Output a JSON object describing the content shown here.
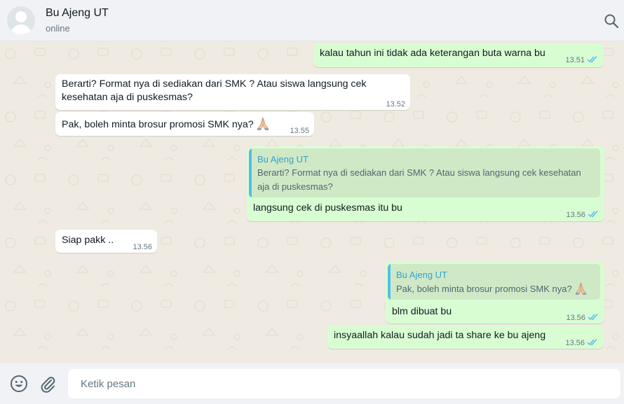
{
  "header": {
    "contact_name": "Bu Ajeng UT",
    "status": "online"
  },
  "messages": [
    {
      "direction": "outgoing",
      "text": "kalau tahun ini tidak ada keterangan buta warna bu",
      "time": "13.51",
      "read": true
    },
    {
      "direction": "incoming",
      "text": "Berarti? Format nya di sediakan dari SMK ? Atau siswa langsung cek kesehatan aja di puskesmas?",
      "time": "13.52"
    },
    {
      "direction": "incoming",
      "text": "Pak, boleh minta brosur promosi SMK nya?",
      "emoji": "folded-hands",
      "time": "13.55"
    },
    {
      "direction": "outgoing",
      "quote": {
        "author": "Bu Ajeng UT",
        "text": "Berarti? Format nya di sediakan dari SMK ? Atau siswa langsung cek kesehatan aja di puskesmas?"
      },
      "text": "langsung cek di puskesmas itu bu",
      "time": "13.56",
      "read": true
    },
    {
      "direction": "incoming",
      "text": "Siap pakk ..",
      "time": "13.56"
    },
    {
      "direction": "outgoing",
      "quote": {
        "author": "Bu Ajeng UT",
        "text": "Pak, boleh minta brosur promosi SMK nya?",
        "emoji": "folded-hands"
      },
      "text": "blm dibuat bu",
      "time": "13.56",
      "read": true
    },
    {
      "direction": "outgoing",
      "text": "insyaallah kalau sudah jadi ta share ke bu ajeng",
      "time": "13.56",
      "read": true
    }
  ],
  "composer": {
    "placeholder": "Ketik pesan"
  },
  "icons": {
    "search": "search-icon",
    "emoji": "smiley-icon",
    "attach": "paperclip-icon",
    "read_receipt": "double-check-icon"
  },
  "colors": {
    "incoming_bubble": "#ffffff",
    "outgoing_bubble": "#d9fdd3",
    "chat_background": "#efeae2",
    "read_tick": "#53bdeb",
    "quote_accent": "#53bdeb"
  }
}
